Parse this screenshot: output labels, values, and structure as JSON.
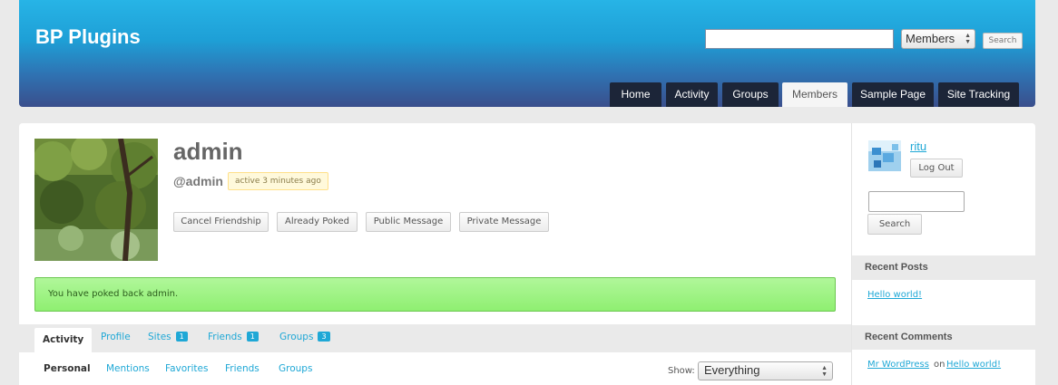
{
  "header": {
    "site_title": "BP Plugins",
    "search": {
      "value": "",
      "select_value": "Members",
      "button_label": "Search"
    },
    "nav": [
      "Home",
      "Activity",
      "Groups",
      "Members",
      "Sample Page",
      "Site Tracking"
    ],
    "nav_active": "Members"
  },
  "profile": {
    "name": "admin",
    "handle": "@admin",
    "activity_badge": "active 3 minutes ago",
    "buttons": [
      "Cancel Friendship",
      "Already Poked",
      "Public Message",
      "Private Message"
    ]
  },
  "notice": "You have poked back admin.",
  "tabs": [
    {
      "label": "Activity",
      "count": null
    },
    {
      "label": "Profile",
      "count": null
    },
    {
      "label": "Sites",
      "count": "1"
    },
    {
      "label": "Friends",
      "count": "1"
    },
    {
      "label": "Groups",
      "count": "3"
    }
  ],
  "subnav": [
    "Personal",
    "Mentions",
    "Favorites",
    "Friends",
    "Groups"
  ],
  "filter": {
    "label": "Show:",
    "value": "Everything"
  },
  "sidebar": {
    "user": "ritu",
    "logout_label": "Log Out",
    "search_button": "Search",
    "recent_posts_title": "Recent Posts",
    "recent_posts": [
      "Hello world!"
    ],
    "recent_comments_title": "Recent Comments",
    "recent_comment": {
      "author": "Mr WordPress",
      "connector": "on",
      "post": "Hello world!"
    }
  },
  "colors": {
    "accent": "#1fa8d6",
    "nav_dark": "#1c2538",
    "notice_green": "#98f27b"
  }
}
